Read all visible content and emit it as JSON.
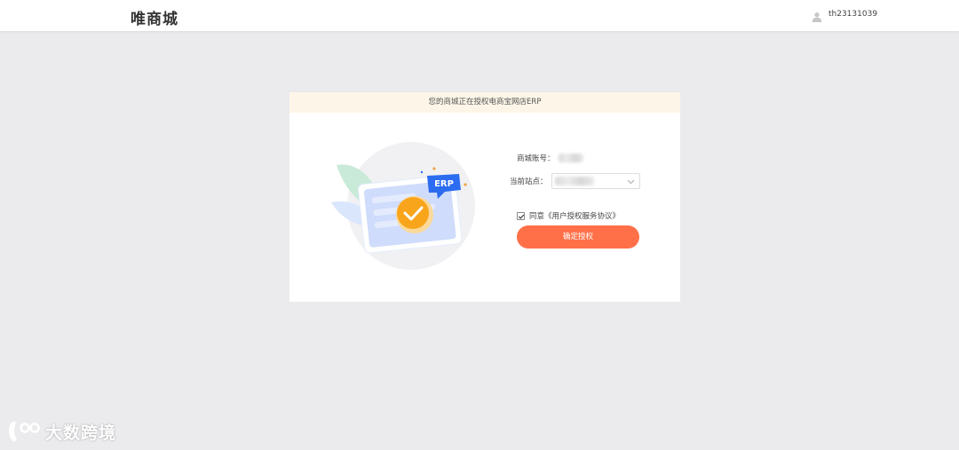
{
  "header": {
    "brand": "唯商城",
    "user": {
      "icon": "user-icon",
      "name": "th23131039"
    }
  },
  "auth_card": {
    "banner_text": "您的商城正在授权电商宝网店ERP",
    "illustration": {
      "badge_text": "ERP",
      "icon": "check-icon"
    },
    "account_label": "商城账号：",
    "site_label": "当前站点：",
    "site_select": {
      "icon": "chevron-down-icon"
    },
    "agreement": {
      "checked": true,
      "text": "同意《用户授权服务协议》"
    },
    "confirm_button": "确定授权"
  },
  "watermark": {
    "text": "大数跨境"
  },
  "colors": {
    "page_bg": "#ebebee",
    "banner_bg": "#fdf6e8",
    "accent_button": "#ff7048",
    "badge_blue": "#2b6cf0",
    "check_orange": "#f8a51c"
  }
}
